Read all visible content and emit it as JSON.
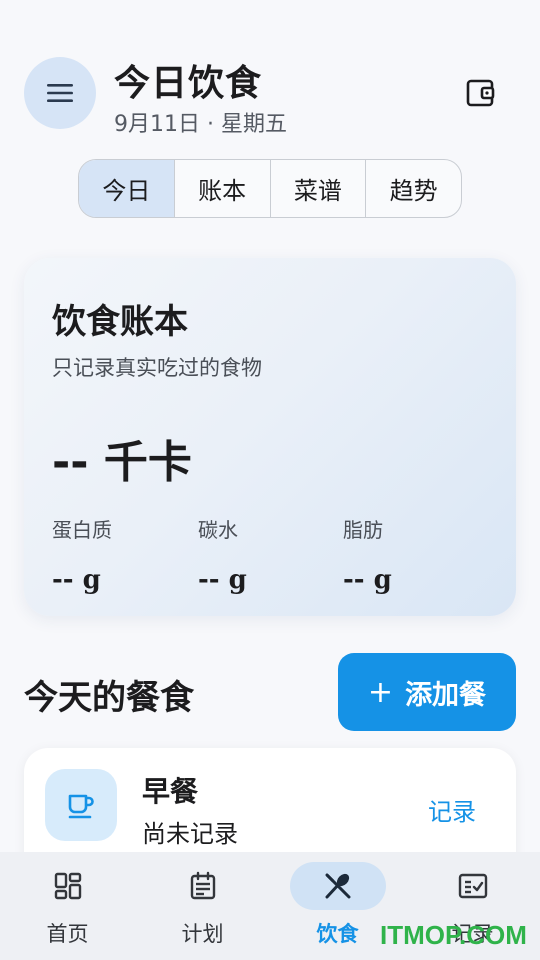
{
  "header": {
    "title": "今日饮食",
    "date": "9月11日 · 星期五",
    "menu_icon": "menu-icon",
    "wallet_icon": "wallet-icon"
  },
  "tabs": [
    {
      "label": "今日",
      "active": true
    },
    {
      "label": "账本",
      "active": false
    },
    {
      "label": "菜谱",
      "active": false
    },
    {
      "label": "趋势",
      "active": false
    }
  ],
  "ledger": {
    "title": "饮食账本",
    "subtitle": "只记录真实吃过的食物",
    "calories": "-- 千卡",
    "macros": [
      {
        "label": "蛋白质",
        "value": "-- g"
      },
      {
        "label": "碳水",
        "value": "-- g"
      },
      {
        "label": "脂肪",
        "value": "-- g"
      }
    ]
  },
  "meals_section": {
    "title": "今天的餐食",
    "add_button": "添加餐",
    "add_icon": "+"
  },
  "meals": [
    {
      "name": "早餐",
      "status": "尚未记录",
      "action": "记录",
      "icon": "cup-icon"
    }
  ],
  "bottom_nav": [
    {
      "label": "首页",
      "icon": "dashboard-icon",
      "active": false
    },
    {
      "label": "计划",
      "icon": "calendar-icon",
      "active": false
    },
    {
      "label": "饮食",
      "icon": "utensils-icon",
      "active": true
    },
    {
      "label": "记录",
      "icon": "checklist-icon",
      "active": false
    }
  ],
  "watermark": "ITMOP.COM",
  "colors": {
    "accent": "#1592e6",
    "tab_active_bg": "#d6e4f6",
    "meal_icon_bg": "#d7ebfb",
    "watermark": "#2fb34a"
  }
}
